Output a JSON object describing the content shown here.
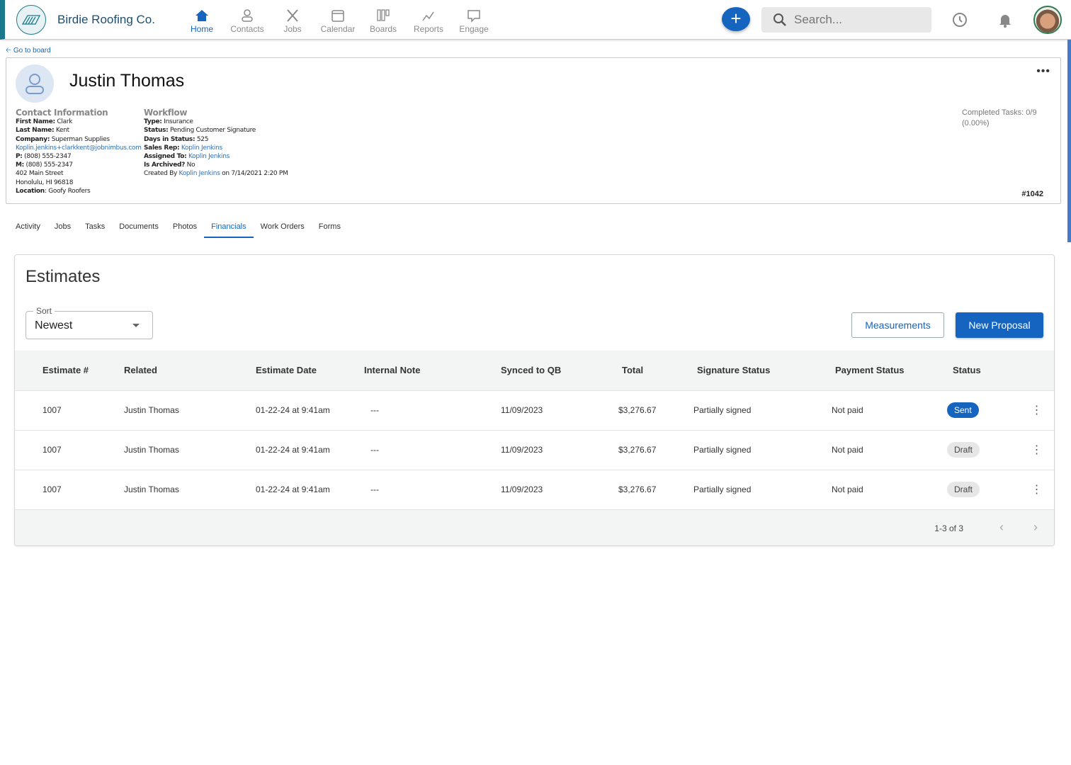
{
  "header": {
    "brand": "Birdie Roofing Co.",
    "nav": [
      {
        "label": "Home",
        "icon": "home-icon",
        "active": true
      },
      {
        "label": "Contacts",
        "icon": "person-icon"
      },
      {
        "label": "Jobs",
        "icon": "tools-icon"
      },
      {
        "label": "Calendar",
        "icon": "calendar-icon"
      },
      {
        "label": "Boards",
        "icon": "boards-icon"
      },
      {
        "label": "Reports",
        "icon": "reports-icon"
      },
      {
        "label": "Engage",
        "icon": "chat-icon"
      }
    ],
    "add": "+",
    "search_placeholder": "Search..."
  },
  "back_link": "Go to board",
  "contact": {
    "name": "Justin Thomas",
    "info_title": "Contact Information",
    "first_name_label": "First Name:",
    "first_name": "Clark",
    "last_name_label": "Last Name:",
    "last_name": "Kent",
    "company_label": "Company:",
    "company": "Superman Supplies",
    "email": "Koplin.jenkins+clarkkent@jobnimbus.com",
    "p_label": "P:",
    "phone": "(808) 555-2347",
    "m_label": "M:",
    "mobile": "(808) 555-2347",
    "street": "402 Main Street",
    "city": "Honolulu, HI 96818",
    "location_label": "Location",
    "location": ": Goofy Roofers"
  },
  "workflow": {
    "title": "Workflow",
    "type_label": "Type:",
    "type": "Insurance",
    "status_label": "Status:",
    "status": "Pending Customer Signature",
    "days_label": "Days in Status:",
    "days": "525",
    "rep_label": "Sales Rep:",
    "rep": "Koplin Jenkins",
    "assigned_label": "Assigned To:",
    "assigned": "Koplin Jenkins",
    "archived_label": "Is Archived?",
    "archived": "No",
    "created_prefix": "Created By",
    "created_by": "Koplin Jenkins",
    "created_on": "on 7/14/2021 2:20 PM"
  },
  "completed": "Completed Tasks: 0/9 (0.00%)",
  "record_number": "#1042",
  "more": "•••",
  "tabs": [
    {
      "label": "Activity"
    },
    {
      "label": "Jobs"
    },
    {
      "label": "Tasks"
    },
    {
      "label": "Documents"
    },
    {
      "label": "Photos"
    },
    {
      "label": "Financials",
      "active": true
    },
    {
      "label": "Work Orders"
    },
    {
      "label": "Forms"
    }
  ],
  "estimates": {
    "title": "Estimates",
    "sort_label": "Sort",
    "sort_value": "Newest",
    "measurements": "Measurements",
    "new_proposal": "New Proposal",
    "columns": [
      "Estimate #",
      "Related",
      "Estimate Date",
      "Internal Note",
      "Synced to QB",
      "Total",
      "Signature Status",
      "Payment Status",
      "Status"
    ],
    "rows": [
      {
        "num": "1007",
        "related": "Justin Thomas",
        "date": "01-22-24 at 9:41am",
        "note": "---",
        "synced": "11/09/2023",
        "total": "$3,276.67",
        "sig": "Partially signed",
        "pay": "Not paid",
        "status": "Sent"
      },
      {
        "num": "1007",
        "related": "Justin Thomas",
        "date": "01-22-24 at 9:41am",
        "note": "---",
        "synced": "11/09/2023",
        "total": "$3,276.67",
        "sig": "Partially signed",
        "pay": "Not paid",
        "status": "Draft"
      },
      {
        "num": "1007",
        "related": "Justin Thomas",
        "date": "01-22-24 at 9:41am",
        "note": "---",
        "synced": "11/09/2023",
        "total": "$3,276.67",
        "sig": "Partially signed",
        "pay": "Not paid",
        "status": "Draft"
      }
    ],
    "pagination": "1-3 of 3"
  },
  "colors": {
    "primary": "#1565c0",
    "brand_teal": "#1a7a8c"
  }
}
